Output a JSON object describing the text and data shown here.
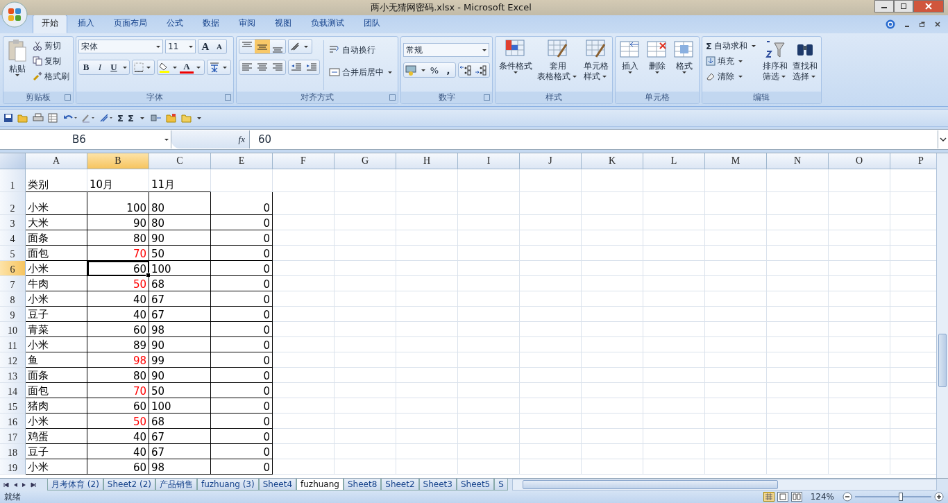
{
  "window": {
    "title": "两小无猜网密码.xlsx - Microsoft Excel"
  },
  "tabs": [
    {
      "label": "开始",
      "selected": true
    },
    {
      "label": "插入",
      "selected": false
    },
    {
      "label": "页面布局",
      "selected": false
    },
    {
      "label": "公式",
      "selected": false
    },
    {
      "label": "数据",
      "selected": false
    },
    {
      "label": "审阅",
      "selected": false
    },
    {
      "label": "视图",
      "selected": false
    },
    {
      "label": "负载测试",
      "selected": false
    },
    {
      "label": "团队",
      "selected": false
    }
  ],
  "ribbon": {
    "clipboard": {
      "label": "剪贴板",
      "paste": "粘贴",
      "cut": "剪切",
      "copy": "复制",
      "format_painter": "格式刷"
    },
    "font": {
      "label": "字体",
      "font_name": "宋体",
      "font_size": "11",
      "grow": "A",
      "shrink": "A",
      "bold": "B",
      "italic": "I",
      "underline": "U",
      "font_color": "A"
    },
    "alignment": {
      "label": "对齐方式",
      "wrap_text": "自动换行",
      "merge_center": "合并后居中",
      "vertical_align": [
        {
          "selected": false
        },
        {
          "selected": true
        },
        {
          "selected": false
        }
      ]
    },
    "number": {
      "label": "数字",
      "format": "常规",
      "percent": "%",
      "comma": ","
    },
    "styles": {
      "label": "样式",
      "items": [
        {
          "lines": [
            "条件格式"
          ]
        },
        {
          "lines": [
            "套用",
            "表格格式"
          ]
        },
        {
          "lines": [
            "单元格",
            "样式"
          ]
        }
      ]
    },
    "cells": {
      "label": "单元格",
      "items": [
        {
          "lines": [
            "插入"
          ]
        },
        {
          "lines": [
            "删除"
          ]
        },
        {
          "lines": [
            "格式"
          ]
        }
      ]
    },
    "editing": {
      "label": "编辑",
      "sum_sign": "Σ",
      "autosum": "自动求和",
      "fill": "填充",
      "clear": "清除",
      "sort": [
        "排序和",
        "筛选"
      ],
      "find": [
        "查找和",
        "选择"
      ]
    }
  },
  "quick_access": {
    "sum": "Σ",
    "sum_menu": "Σ"
  },
  "formula_bar": {
    "name_box": "B6",
    "fx": "fx",
    "value": "60"
  },
  "sheet": {
    "columns": [
      {
        "label": "A",
        "selected": false
      },
      {
        "label": "B",
        "selected": true
      },
      {
        "label": "C",
        "selected": false
      },
      {
        "label": "E",
        "selected": false
      },
      {
        "label": "F",
        "selected": false
      },
      {
        "label": "G",
        "selected": false
      },
      {
        "label": "H",
        "selected": false
      },
      {
        "label": "I",
        "selected": false
      },
      {
        "label": "J",
        "selected": false
      },
      {
        "label": "K",
        "selected": false
      },
      {
        "label": "L",
        "selected": false
      },
      {
        "label": "M",
        "selected": false
      },
      {
        "label": "N",
        "selected": false
      },
      {
        "label": "O",
        "selected": false
      },
      {
        "label": "P",
        "selected": false
      }
    ],
    "rows": [
      {
        "number": "1",
        "selected": false,
        "oct_warning": false,
        "cells": [
          "类别",
          "10月",
          "11月"
        ]
      },
      {
        "number": "2",
        "selected": false,
        "oct_warning": false,
        "cells": [
          "小米",
          "100",
          "80",
          "0"
        ]
      },
      {
        "number": "3",
        "selected": false,
        "oct_warning": false,
        "cells": [
          "大米",
          "90",
          "80",
          "0"
        ]
      },
      {
        "number": "4",
        "selected": false,
        "oct_warning": false,
        "cells": [
          "面条",
          "80",
          "90",
          "0"
        ]
      },
      {
        "number": "5",
        "selected": false,
        "oct_warning": true,
        "cells": [
          "面包",
          "70",
          "50",
          "0"
        ]
      },
      {
        "number": "6",
        "selected": true,
        "oct_warning": false,
        "cells": [
          "小米",
          "60",
          "100",
          "0"
        ]
      },
      {
        "number": "7",
        "selected": false,
        "oct_warning": true,
        "cells": [
          "牛肉",
          "50",
          "68",
          "0"
        ]
      },
      {
        "number": "8",
        "selected": false,
        "oct_warning": false,
        "cells": [
          "小米",
          "40",
          "67",
          "0"
        ]
      },
      {
        "number": "9",
        "selected": false,
        "oct_warning": false,
        "cells": [
          "豆子",
          "40",
          "67",
          "0"
        ]
      },
      {
        "number": "10",
        "selected": false,
        "oct_warning": false,
        "cells": [
          "青菜",
          "60",
          "98",
          "0"
        ]
      },
      {
        "number": "11",
        "selected": false,
        "oct_warning": false,
        "cells": [
          "小米",
          "89",
          "90",
          "0"
        ]
      },
      {
        "number": "12",
        "selected": false,
        "oct_warning": true,
        "cells": [
          "鱼",
          "98",
          "99",
          "0"
        ]
      },
      {
        "number": "13",
        "selected": false,
        "oct_warning": false,
        "cells": [
          "面条",
          "80",
          "90",
          "0"
        ]
      },
      {
        "number": "14",
        "selected": false,
        "oct_warning": true,
        "cells": [
          "面包",
          "70",
          "50",
          "0"
        ]
      },
      {
        "number": "15",
        "selected": false,
        "oct_warning": false,
        "cells": [
          "猪肉",
          "60",
          "100",
          "0"
        ]
      },
      {
        "number": "16",
        "selected": false,
        "oct_warning": true,
        "cells": [
          "小米",
          "50",
          "68",
          "0"
        ]
      },
      {
        "number": "17",
        "selected": false,
        "oct_warning": false,
        "cells": [
          "鸡蛋",
          "40",
          "67",
          "0"
        ]
      },
      {
        "number": "18",
        "selected": false,
        "oct_warning": false,
        "cells": [
          "豆子",
          "40",
          "67",
          "0"
        ]
      },
      {
        "number": "19",
        "selected": false,
        "oct_warning": false,
        "cells": [
          "小米",
          "60",
          "98",
          "0"
        ]
      }
    ]
  },
  "sheet_tabs": [
    {
      "label": "月考体育 (2)",
      "selected": false
    },
    {
      "label": "Sheet2 (2)",
      "selected": false
    },
    {
      "label": "产品销售",
      "selected": false
    },
    {
      "label": "fuzhuang (3)",
      "selected": false
    },
    {
      "label": "Sheet4",
      "selected": false
    },
    {
      "label": "fuzhuang",
      "selected": true
    },
    {
      "label": "Sheet8",
      "selected": false
    },
    {
      "label": "Sheet2",
      "selected": false
    },
    {
      "label": "Sheet3",
      "selected": false
    },
    {
      "label": "Sheet5",
      "selected": false
    },
    {
      "label": "S",
      "selected": false
    }
  ],
  "status_bar": {
    "mode": "就绪",
    "zoom": "124%",
    "zoom_slider": {
      "level": 0.6
    }
  }
}
